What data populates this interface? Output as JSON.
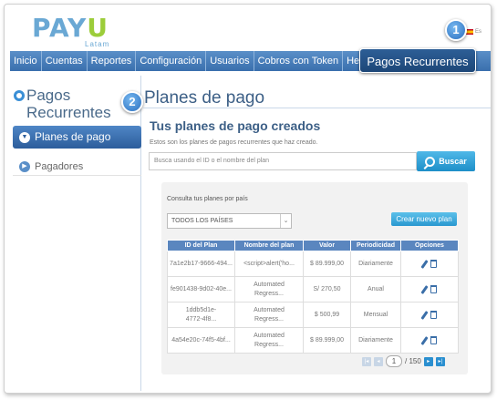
{
  "header": {
    "logo_part1": "PAY",
    "logo_part2": "U",
    "logo_sub": "Latam",
    "lang": "Es"
  },
  "nav": {
    "items": [
      "Inicio",
      "Cuentas",
      "Reportes",
      "Configuración",
      "Usuarios",
      "Cobros con Token",
      "Herramientas"
    ],
    "active": "Pagos Recurrentes"
  },
  "badges": [
    "1",
    "2"
  ],
  "sidebar": {
    "title_line1": "Pagos",
    "title_line2": "Recurrentes",
    "active_item": "Planes de pago",
    "item": "Pagadores"
  },
  "main": {
    "title": "Planes de pago",
    "section_title": "Tus planes de pago creados",
    "section_desc": "Estos son los planes de pagos recurrentes que haz creado.",
    "search_placeholder": "Busca usando el ID o el nombre del plan",
    "search_button": "Buscar"
  },
  "panel": {
    "filter_label": "Consulta tus planes por país",
    "filter_value": "TODOS LOS PAÍSES",
    "create_button": "Crear nuevo plan",
    "columns": [
      "ID del Plan",
      "Nombre del plan",
      "Valor",
      "Periodicidad",
      "Opciones"
    ],
    "rows": [
      {
        "id": "7a1e2b17-9666-494...",
        "name": "<script>alert('ho...",
        "value": "$ 89.999,00",
        "period": "Diariamente"
      },
      {
        "id": "fe901438-9d02-40e...",
        "name": "Automated\nRegress...",
        "value": "S/ 270,50",
        "period": "Anual"
      },
      {
        "id": "1ddb5d1e-\n4772-4f8...",
        "name": "Automated\nRegress...",
        "value": "$ 500,99",
        "period": "Mensual"
      },
      {
        "id": "4a54e20c-74f5-4bf...",
        "name": "Automated\nRegress...",
        "value": "$ 89.999,00",
        "period": "Diariamente"
      }
    ],
    "pager": {
      "first": "|◂",
      "prev": "◂",
      "current": "1",
      "total": "/ 150",
      "next": "▸",
      "last": "▸|"
    }
  }
}
